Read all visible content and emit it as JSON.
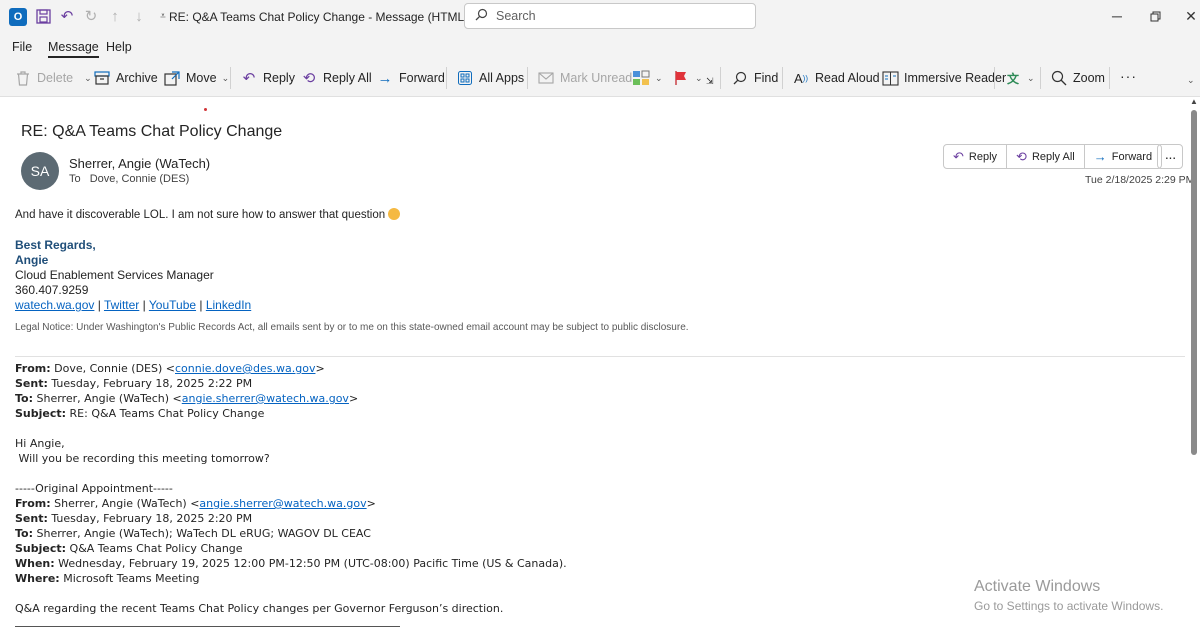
{
  "titlebar": {
    "app_icon_label": "O",
    "title": "RE: Q&A Teams Chat Policy Change  -  Message (HTML)",
    "search_placeholder": "Search",
    "icons": [
      "save-icon",
      "undo-icon",
      "redo-icon",
      "up-arrow-icon",
      "down-arrow-icon",
      "customize-icon"
    ]
  },
  "menu": {
    "file": "File",
    "message": "Message",
    "help": "Help"
  },
  "ribbon": {
    "delete": "Delete",
    "archive": "Archive",
    "move": "Move",
    "reply": "Reply",
    "reply_all": "Reply All",
    "forward": "Forward",
    "all_apps": "All Apps",
    "mark_unread": "Mark Unread",
    "find": "Find",
    "read_aloud": "Read Aloud",
    "immersive_reader": "Immersive Reader",
    "zoom": "Zoom"
  },
  "message": {
    "subject": "RE: Q&A Teams Chat Policy Change",
    "avatar_initials": "SA",
    "sender": "Sherrer, Angie (WaTech)",
    "to_label": "To",
    "to": "Dove, Connie (DES)",
    "timestamp": "Tue 2/18/2025 2:29 PM",
    "actions": {
      "reply": "Reply",
      "reply_all": "Reply All",
      "forward": "Forward"
    }
  },
  "body": {
    "line1": "And have it discoverable LOL.  I am not sure how to answer that question ",
    "signoff": "Best Regards,",
    "name": "Angie",
    "role": "Cloud Enablement Services Manager",
    "phone": "360.407.9259",
    "links": [
      "watech.wa.gov",
      "Twitter",
      "YouTube",
      "LinkedIn"
    ],
    "link_sep": " | ",
    "legal": "Legal Notice: Under Washington's Public Records Act, all emails sent by or to me on this state-owned email account may be subject to public disclosure.",
    "q1": {
      "from_label": "From:",
      "from": " Dove, Connie (DES) <",
      "from_email": "connie.dove@des.wa.gov",
      "from_end": ">",
      "sent_label": "Sent:",
      "sent": " Tuesday, February 18, 2025 2:22 PM",
      "to_label": "To:",
      "to": " Sherrer, Angie (WaTech) <",
      "to_email": "angie.sherrer@watech.wa.gov",
      "to_end": ">",
      "subject_label": "Subject:",
      "subject": " RE: Q&A Teams Chat Policy Change"
    },
    "greeting": "Hi Angie,",
    "question": " Will you be recording this meeting tomorrow?",
    "orig_sep": "-----Original Appointment-----",
    "q2": {
      "from_label": "From:",
      "from": " Sherrer, Angie (WaTech) <",
      "from_email": "angie.sherrer@watech.wa.gov",
      "from_end": ">",
      "sent_label": "Sent:",
      "sent": " Tuesday, February 18, 2025 2:20 PM",
      "to_label": "To:",
      "to": " Sherrer, Angie (WaTech); WaTech DL eRUG; WAGOV DL CEAC",
      "subject_label": "Subject:",
      "subject": " Q&A Teams Chat Policy Change",
      "when_label": "When:",
      "when": " Wednesday, February 19, 2025 12:00 PM-12:50 PM (UTC-08:00) Pacific Time (US & Canada).",
      "where_label": "Where:",
      "where": " Microsoft Teams Meeting"
    },
    "final": "Q&A regarding the recent Teams Chat Policy changes per Governor Ferguson’s direction."
  },
  "watermark": {
    "title": "Activate Windows",
    "subtitle": "Go to Settings to activate Windows."
  }
}
